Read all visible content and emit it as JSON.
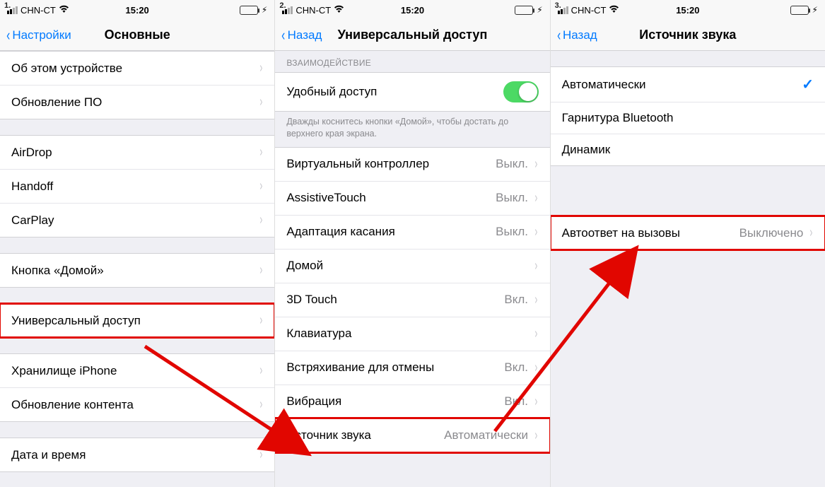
{
  "steps": {
    "s1": "1.",
    "s2": "2.",
    "s3": "3."
  },
  "statusbar": {
    "carrier": "CHN-CT",
    "time": "15:20"
  },
  "screen1": {
    "back": "Настройки",
    "title": "Основные",
    "groups": [
      {
        "cells": [
          {
            "label": "Об этом устройстве"
          },
          {
            "label": "Обновление ПО"
          }
        ]
      },
      {
        "cells": [
          {
            "label": "AirDrop"
          },
          {
            "label": "Handoff"
          },
          {
            "label": "CarPlay"
          }
        ]
      },
      {
        "cells": [
          {
            "label": "Кнопка «Домой»"
          }
        ]
      },
      {
        "cells": [
          {
            "label": "Универсальный доступ",
            "highlight": true
          }
        ]
      },
      {
        "cells": [
          {
            "label": "Хранилище iPhone"
          },
          {
            "label": "Обновление контента"
          }
        ]
      },
      {
        "cells": [
          {
            "label": "Дата и время"
          }
        ]
      }
    ]
  },
  "screen2": {
    "back": "Назад",
    "title": "Универсальный доступ",
    "sectionHeader": "ВЗАИМОДЕЙСТВИЕ",
    "toggleRow": {
      "label": "Удобный доступ",
      "on": true
    },
    "footer": "Дважды коснитесь кнопки «Домой», чтобы достать до верхнего края экрана.",
    "rows": [
      {
        "label": "Виртуальный контроллер",
        "value": "Выкл."
      },
      {
        "label": "AssistiveTouch",
        "value": "Выкл."
      },
      {
        "label": "Адаптация касания",
        "value": "Выкл."
      },
      {
        "label": "Домой",
        "value": ""
      },
      {
        "label": "3D Touch",
        "value": "Вкл."
      },
      {
        "label": "Клавиатура",
        "value": ""
      },
      {
        "label": "Встряхивание для отмены",
        "value": "Вкл."
      },
      {
        "label": "Вибрация",
        "value": "Вкл."
      },
      {
        "label": "Источник звука",
        "value": "Автоматически",
        "highlight": true
      }
    ]
  },
  "screen3": {
    "back": "Назад",
    "title": "Источник звука",
    "options": [
      {
        "label": "Автоматически",
        "checked": true
      },
      {
        "label": "Гарнитура Bluetooth"
      },
      {
        "label": "Динамик"
      }
    ],
    "autoAnswer": {
      "label": "Автоответ на вызовы",
      "value": "Выключено",
      "highlight": true
    }
  }
}
